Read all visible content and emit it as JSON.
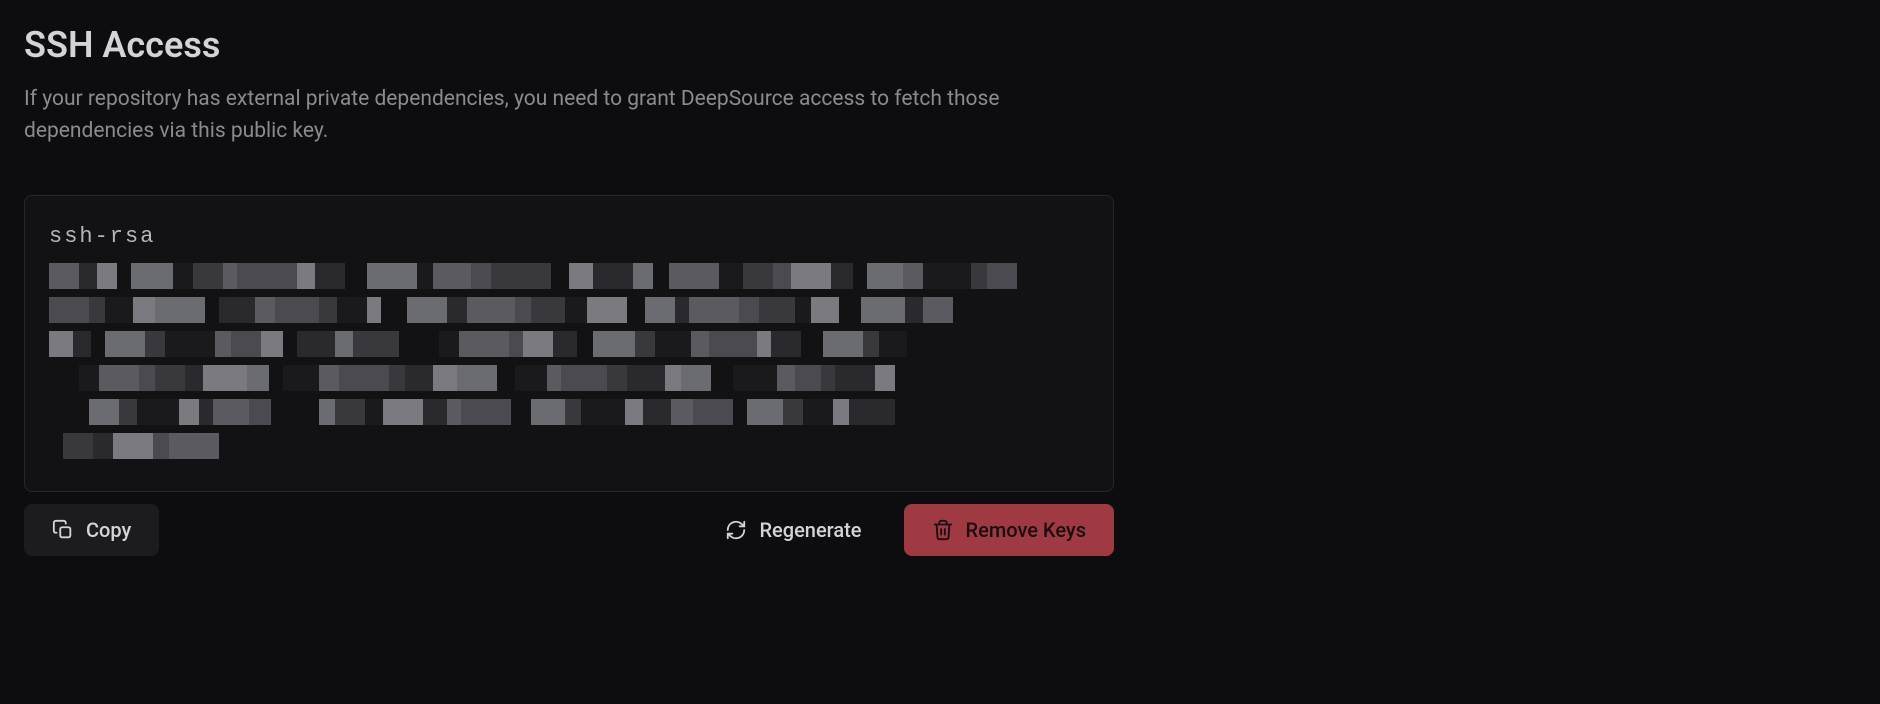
{
  "section": {
    "title": "SSH Access",
    "description": "If your repository has external private dependencies, you need to grant DeepSource access to fetch those dependencies via this public key."
  },
  "ssh_key": {
    "prefix": "ssh-rsa",
    "redacted": true
  },
  "buttons": {
    "copy": "Copy",
    "regenerate": "Regenerate",
    "remove": "Remove Keys"
  }
}
